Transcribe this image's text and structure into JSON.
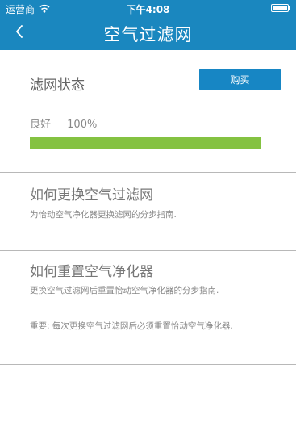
{
  "status_bar": {
    "carrier": "运营商",
    "time": "下午4:08",
    "icons": [
      "wifi-icon",
      "battery-icon"
    ]
  },
  "nav": {
    "title": "空气过滤网",
    "back_icon": "chevron-left-icon"
  },
  "filter": {
    "label": "滤网状态",
    "buy_label": "购买",
    "condition": "良好",
    "percent": "100%",
    "level": 1.0
  },
  "guides": [
    {
      "heading": "如何更换空气过滤网",
      "description": "为怡动空气净化器更换滤网的分步指南."
    },
    {
      "heading": "如何重置空气净化器",
      "description": "更换空气过滤网后重置怡动空气净化器的分步指南.",
      "note": "重要: 每次更换空气过滤网后必须重置怡动空气净化器."
    }
  ],
  "colors": {
    "header": "#1a87bf",
    "button": "#1786c4",
    "progress": "#84c241"
  }
}
